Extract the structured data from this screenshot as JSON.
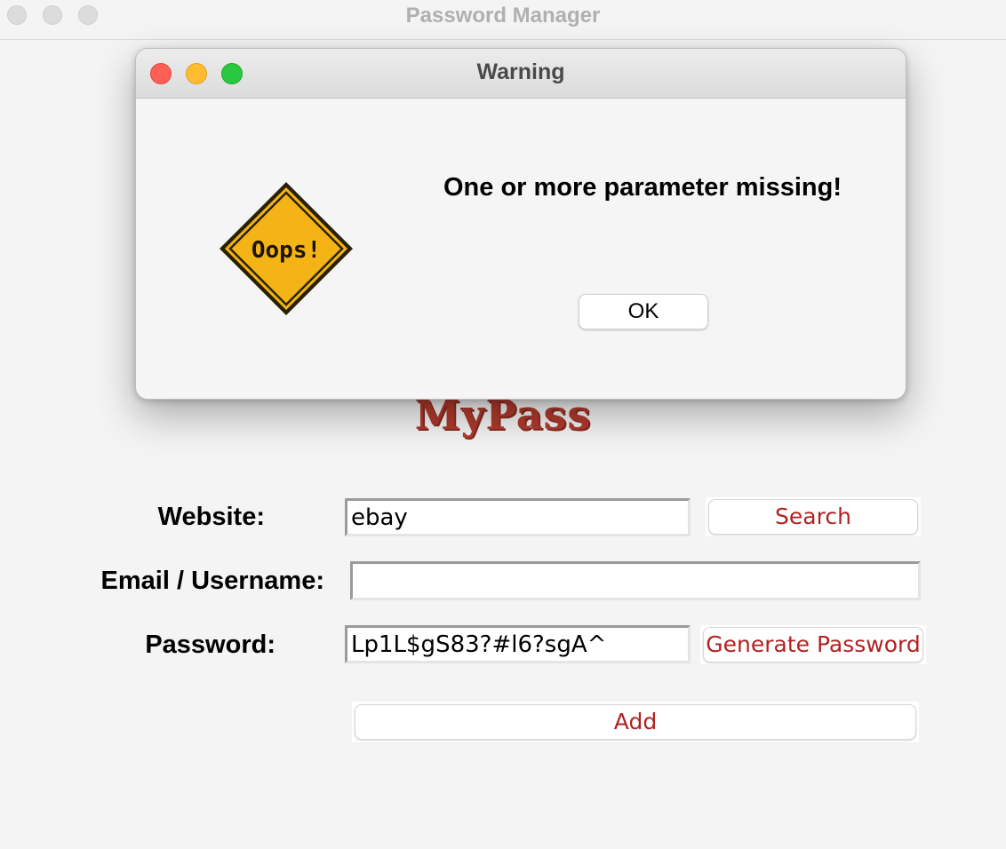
{
  "window": {
    "title": "Password Manager"
  },
  "logo": {
    "text": "MyPass"
  },
  "form": {
    "website_label": "Website:",
    "website_value": "ebay",
    "search_label": "Search",
    "email_label": "Email / Username:",
    "email_value": "",
    "password_label": "Password:",
    "password_value": "Lp1L$gS83?#l6?sgA^",
    "generate_label": "Generate Password",
    "add_label": "Add"
  },
  "dialog": {
    "title": "Warning",
    "message": "One or more parameter missing!",
    "ok_label": "OK",
    "icon": "oops-warning-sign",
    "icon_text": "Oops!"
  },
  "colors": {
    "accent": "#b22222",
    "logo": "#b03a2e",
    "sign": "#f5b416",
    "close": "#fe5f57",
    "minimize": "#febc2e",
    "zoom": "#28c840"
  }
}
